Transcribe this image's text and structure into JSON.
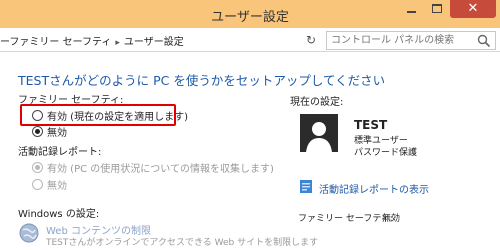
{
  "window": {
    "title": "ユーザー設定"
  },
  "address": {
    "breadcrumb": [
      "ーファミリー セーフティ",
      "ユーザー設定"
    ],
    "search_placeholder": "コントロール パネルの検索"
  },
  "main": {
    "heading": "TESTさんがどのように PC を使うかをセットアップしてください",
    "family_safety": {
      "label": "ファミリー セーフティ:",
      "options": [
        {
          "label": "有効 (現在の設定を適用します)",
          "selected": false
        },
        {
          "label": "無効",
          "selected": true
        }
      ]
    },
    "activity_report": {
      "label": "活動記録レポート:",
      "options": [
        {
          "label": "有効 (PC の使用状況についての情報を収集します)",
          "selected": true,
          "disabled": true
        },
        {
          "label": "無効",
          "selected": false,
          "disabled": true
        }
      ]
    },
    "windows_settings": {
      "label": "Windows の設定:",
      "web_title": "Web コンテンツの制限",
      "web_desc": "TESTさんがオンラインでアクセスできる Web サイトを制限します"
    }
  },
  "side": {
    "current_label": "現在の設定:",
    "user": {
      "name": "TEST",
      "type": "標準ユーザー",
      "password": "パスワード保護"
    },
    "report_link": "活動記録レポートの表示",
    "family_safety_label": "ファミリー セーフティ:",
    "family_safety_value": "無効"
  },
  "colors": {
    "accent": "#1e5aa8",
    "titlebar": "#f8c57a",
    "close": "#c74b3a",
    "highlight": "#e00000"
  }
}
